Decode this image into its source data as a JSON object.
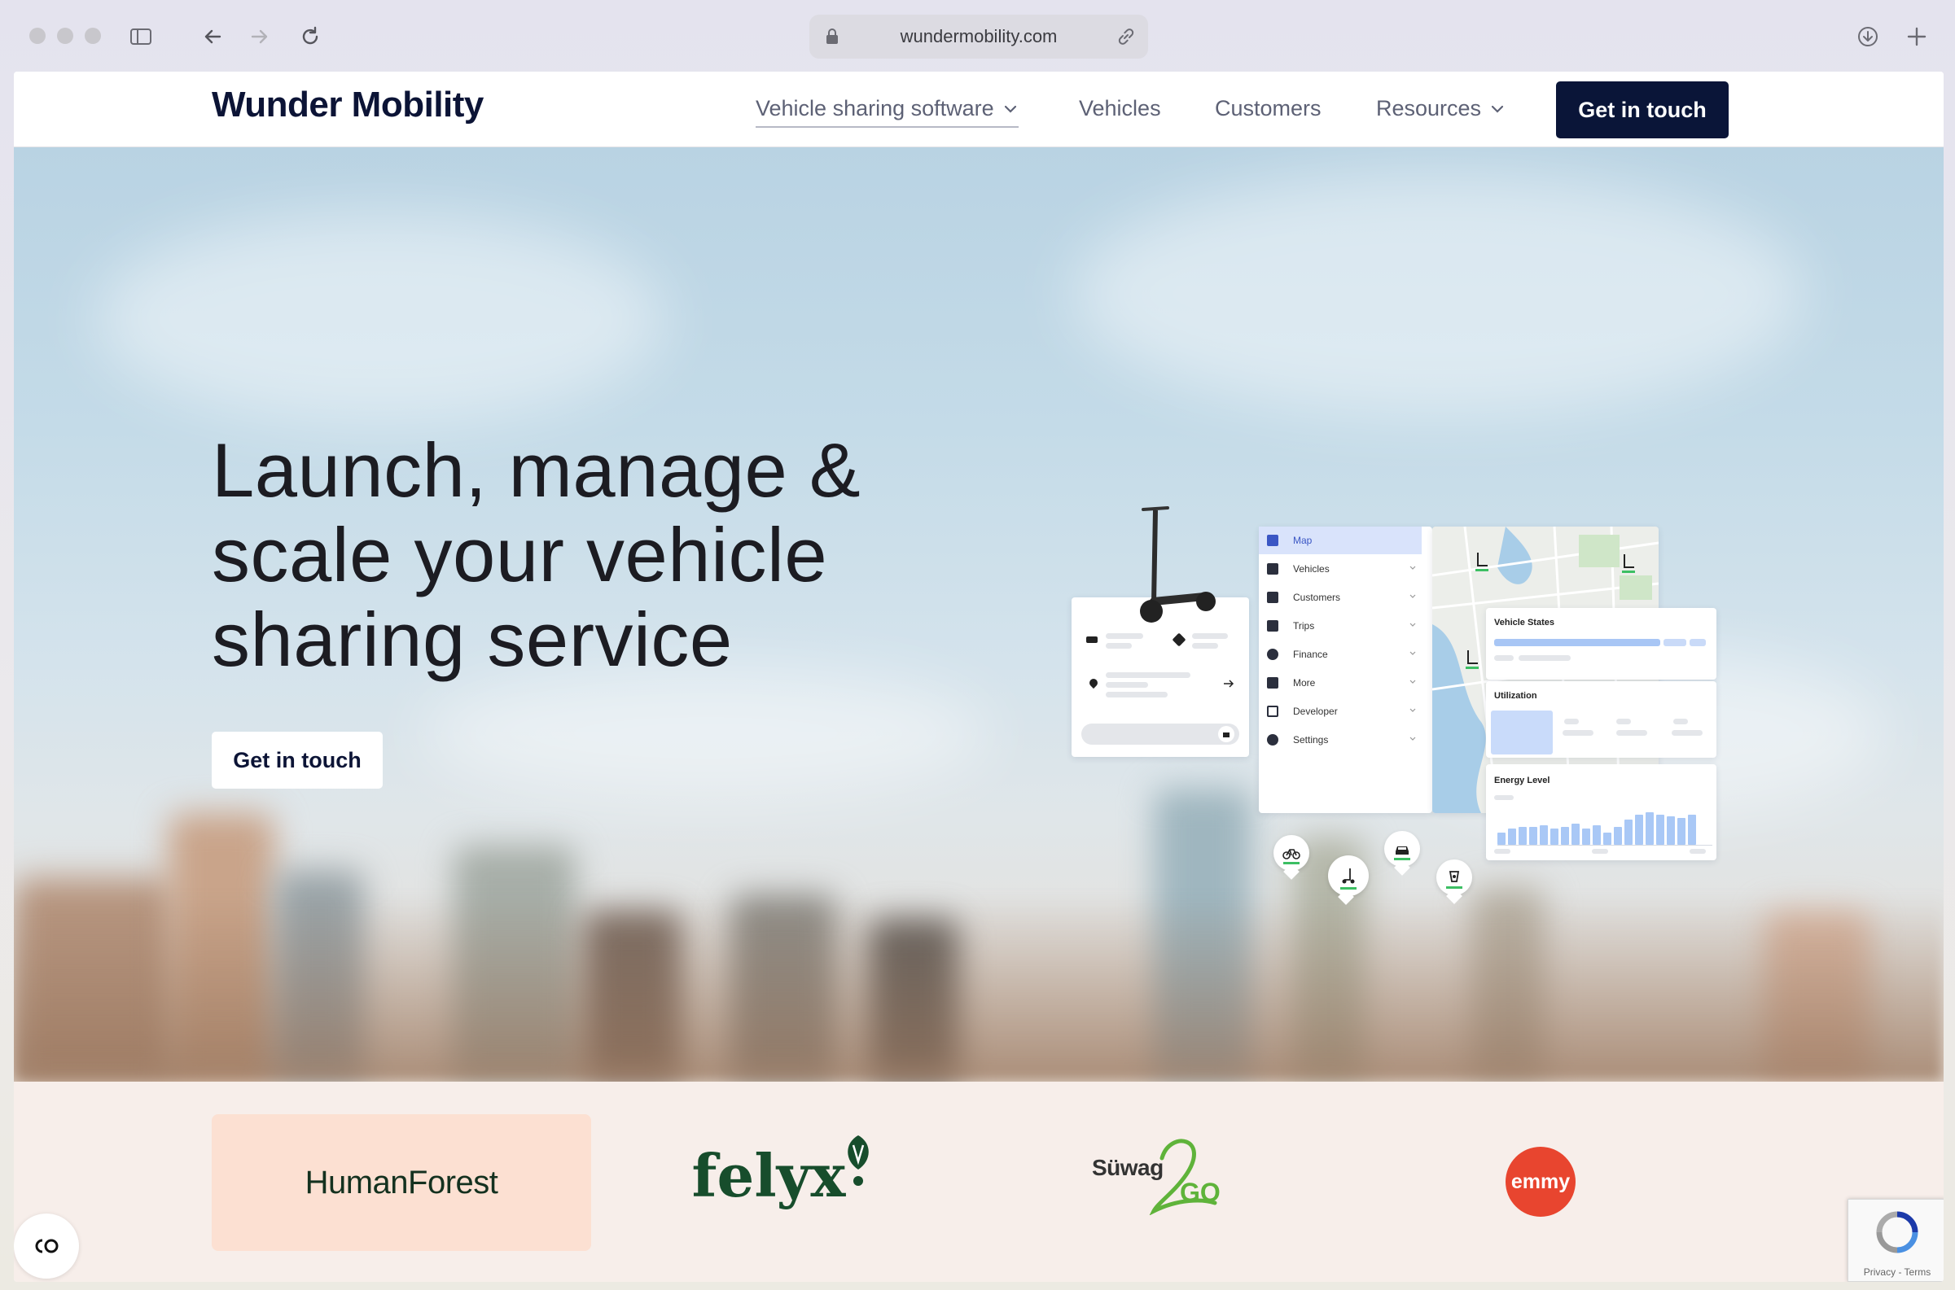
{
  "browser": {
    "url": "wundermobility.com"
  },
  "nav": {
    "brand": "Wunder Mobility",
    "items": [
      {
        "label": "Vehicle sharing software",
        "dropdown": true
      },
      {
        "label": "Vehicles",
        "dropdown": false
      },
      {
        "label": "Customers",
        "dropdown": false
      },
      {
        "label": "Resources",
        "dropdown": true
      }
    ],
    "cta": "Get in touch"
  },
  "hero": {
    "headline": "Launch, manage & scale your vehicle sharing service",
    "cta": "Get in touch"
  },
  "dashboard": {
    "sidebar": [
      "Map",
      "Vehicles",
      "Customers",
      "Trips",
      "Finance",
      "More",
      "Developer",
      "Settings"
    ],
    "cards": {
      "vehicle_states": "Vehicle States",
      "utilization": "Utilization",
      "energy_level": "Energy Level"
    },
    "energy_bars": [
      0.35,
      0.45,
      0.5,
      0.5,
      0.55,
      0.45,
      0.5,
      0.6,
      0.45,
      0.55,
      0.35,
      0.5,
      0.7,
      0.85,
      0.9,
      0.85,
      0.8,
      0.75,
      0.85
    ]
  },
  "partners": {
    "humanforest": "HumanForest",
    "felyx": "felyx",
    "suwag": "Süwag",
    "suwag_go": "GO",
    "emmy": "emmy"
  },
  "recaptcha": {
    "terms": "Privacy - Terms"
  },
  "colors": {
    "navy": "#0a1538",
    "partner_bg": "#f7eeea",
    "humanforest_bg": "#fce0d2",
    "felyx_green": "#174d2c",
    "emmy_red": "#e8452f",
    "dashboard_accent": "#3a56c4"
  }
}
